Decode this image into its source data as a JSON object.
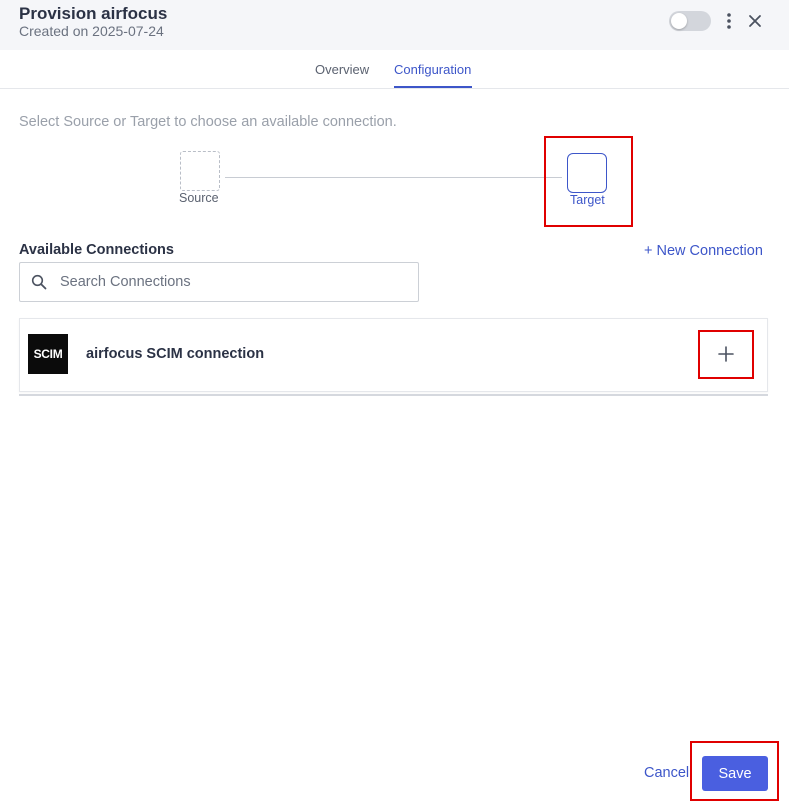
{
  "header": {
    "title": "Provision airfocus",
    "subtitle": "Created on 2025-07-24",
    "toggle_on": false,
    "icons": [
      "more-vertical-icon",
      "close-icon"
    ]
  },
  "tabs": [
    {
      "label": "Overview",
      "active": false
    },
    {
      "label": "Configuration",
      "active": true
    }
  ],
  "config": {
    "hint": "Select Source or Target to choose an available connection.",
    "source_label": "Source",
    "target_label": "Target"
  },
  "connections": {
    "title": "Available Connections",
    "new_label": "+ New Connection",
    "search_placeholder": "Search Connections",
    "items": [
      {
        "logo_text": "SCIM",
        "name": "airfocus SCIM connection"
      }
    ]
  },
  "footer": {
    "cancel_label": "Cancel",
    "save_label": "Save"
  },
  "colors": {
    "accent": "#3d56c9",
    "primary_button": "#4a5fe0",
    "highlight": "#e00000",
    "header_bg": "#f5f6f9"
  }
}
